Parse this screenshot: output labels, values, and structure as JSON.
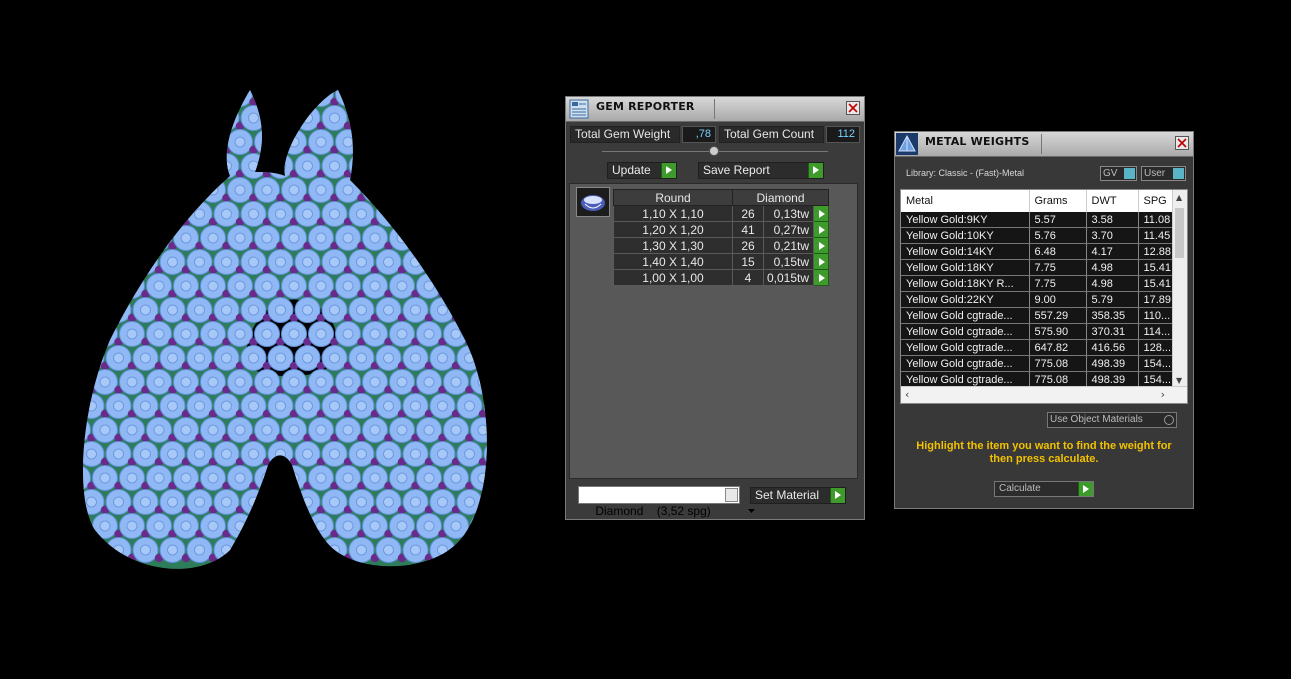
{
  "gem_reporter": {
    "title": "GEM REPORTER",
    "total_gem_weight_label": "Total Gem Weight",
    "total_gem_weight_value": ",78",
    "total_gem_count_label": "Total Gem Count",
    "total_gem_count_value": "112",
    "update_label": "Update",
    "save_report_label": "Save Report",
    "table": {
      "shape_header": "Round",
      "material_header": "Diamond",
      "rows": [
        {
          "size": "1,10 X 1,10",
          "count": "26",
          "weight": "0,13tw"
        },
        {
          "size": "1,20 X 1,20",
          "count": "41",
          "weight": "0,27tw"
        },
        {
          "size": "1,30 X 1,30",
          "count": "26",
          "weight": "0,21tw"
        },
        {
          "size": "1,40 X 1,40",
          "count": "15",
          "weight": "0,15tw"
        },
        {
          "size": "1,00 X 1,00",
          "count": "4",
          "weight": "0,015tw"
        }
      ]
    },
    "material_select": "Diamond    (3,52 spg)",
    "set_material_label": "Set Material"
  },
  "metal_weights": {
    "title": "METAL WEIGHTS",
    "library_label": "Library: Classic - (Fast)-Metal",
    "gv_label": "GV",
    "user_label": "User",
    "columns": [
      "Metal",
      "Grams",
      "DWT",
      "SPG"
    ],
    "rows": [
      [
        "Yellow Gold:9KY",
        "5.57",
        "3.58",
        "11.08"
      ],
      [
        "Yellow Gold:10KY",
        "5.76",
        "3.70",
        "11.45"
      ],
      [
        "Yellow Gold:14KY",
        "6.48",
        "4.17",
        "12.88"
      ],
      [
        "Yellow Gold:18KY",
        "7.75",
        "4.98",
        "15.41"
      ],
      [
        "Yellow Gold:18KY R...",
        "7.75",
        "4.98",
        "15.41"
      ],
      [
        "Yellow Gold:22KY",
        "9.00",
        "5.79",
        "17.89"
      ],
      [
        "Yellow Gold cgtrade...",
        "557.29",
        "358.35",
        "110..."
      ],
      [
        "Yellow Gold cgtrade...",
        "575.90",
        "370.31",
        "114..."
      ],
      [
        "Yellow Gold cgtrade...",
        "647.82",
        "416.56",
        "128..."
      ],
      [
        "Yellow Gold cgtrade...",
        "775.08",
        "498.39",
        "154..."
      ],
      [
        "Yellow Gold cgtrade...",
        "775.08",
        "498.39",
        "154..."
      ]
    ],
    "use_object_materials_label": "Use Object Materials",
    "hint": "Highlight the item you want to find the weight for then press calculate.",
    "calculate_label": "Calculate"
  },
  "colors": {
    "gem_blue": "#8fb8f5",
    "prong_purple": "#6a2a8a",
    "metal_green": "#2e7d5a",
    "panel_bg": "#3b3b3b",
    "go_green": "#3f9a2c",
    "hint_yellow": "#f2c200",
    "value_blue": "#7ad0ff"
  }
}
